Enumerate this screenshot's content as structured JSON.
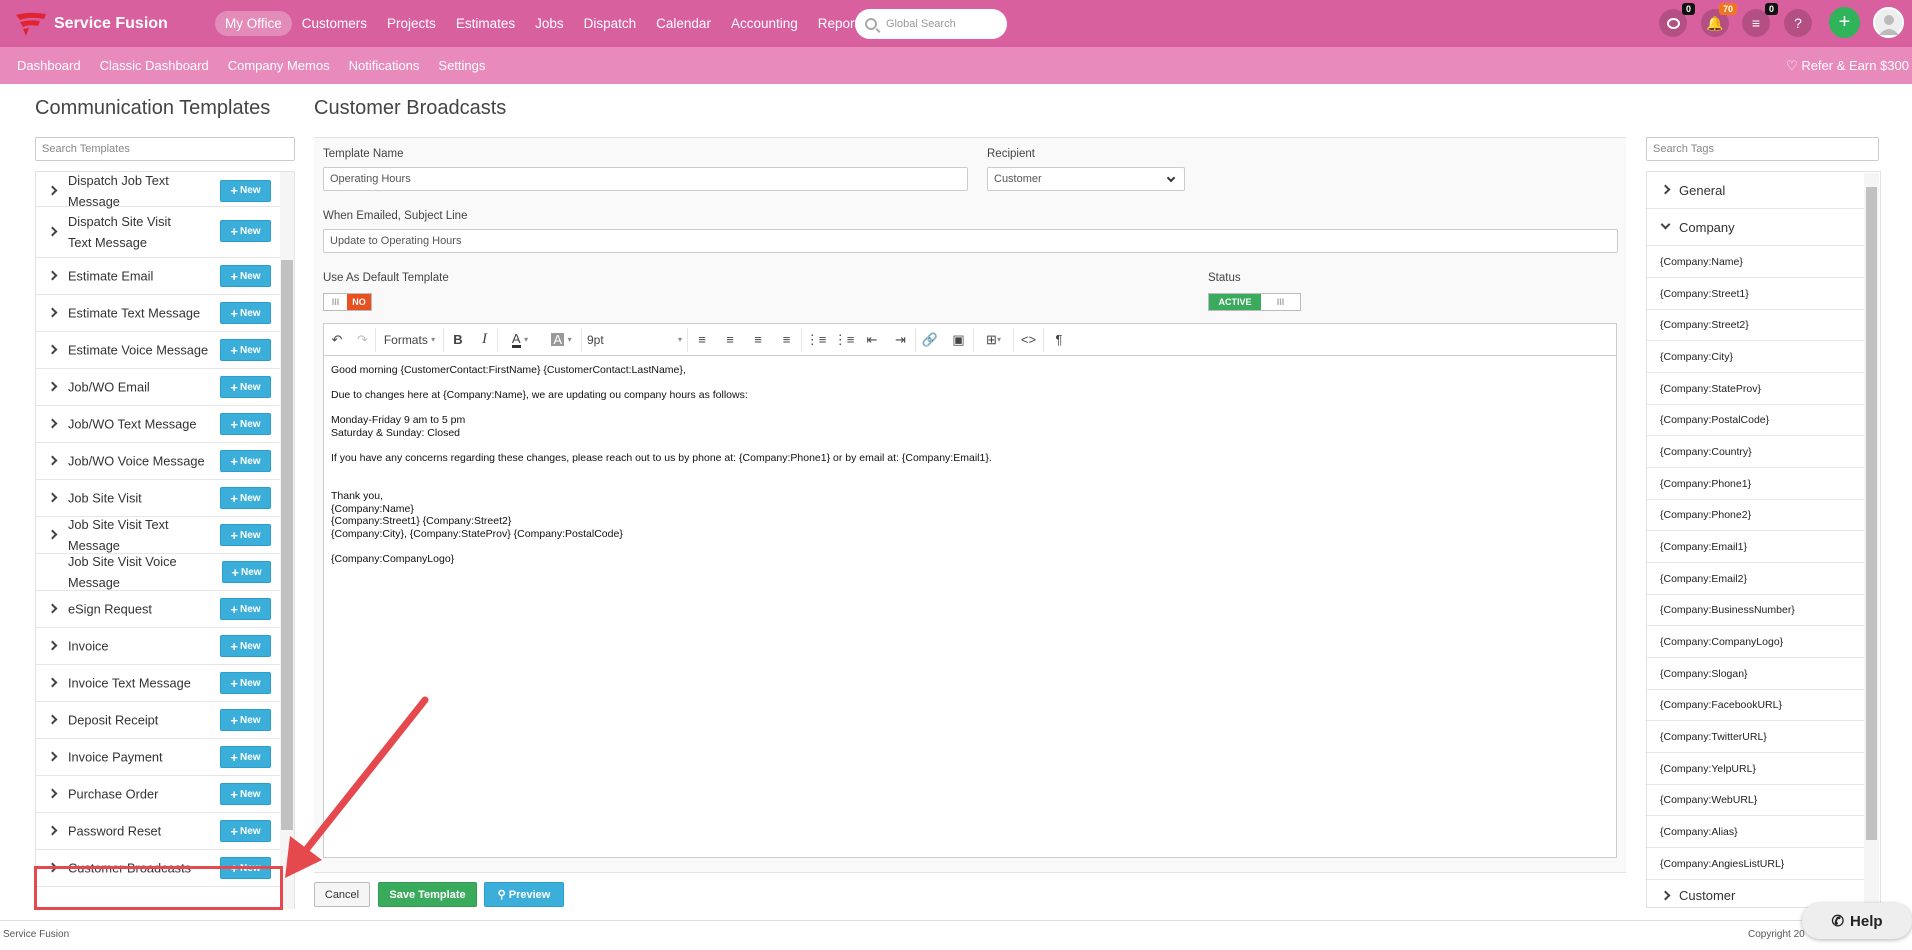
{
  "app": {
    "brand": "Service Fusion",
    "accent": "#d9609f",
    "subbar_color": "#e98abd"
  },
  "nav": {
    "items": [
      "My Office",
      "Customers",
      "Projects",
      "Estimates",
      "Jobs",
      "Dispatch",
      "Calendar",
      "Accounting",
      "Reports"
    ],
    "active": "My Office",
    "search_placeholder": "Global Search",
    "badges": {
      "chat": "0",
      "notifications": "70",
      "tasks": "0"
    },
    "help_label": "?"
  },
  "subnav": {
    "items": [
      "Dashboard",
      "Classic Dashboard",
      "Company Memos",
      "Notifications",
      "Settings"
    ],
    "refer": "♡  Refer & Earn $300"
  },
  "left": {
    "title": "Communication Templates",
    "search_placeholder": "Search Templates",
    "new_label": "New",
    "templates": [
      "Dispatch Job Text Message",
      "Dispatch Site Visit Text Message",
      "Estimate Email",
      "Estimate Text Message",
      "Estimate Voice Message",
      "Job/WO Email",
      "Job/WO Text Message",
      "Job/WO Voice Message",
      "Job Site Visit",
      "Job Site Visit Text Message",
      "Job Site Visit Voice Message",
      "eSign Request",
      "Invoice",
      "Invoice Text Message",
      "Deposit Receipt",
      "Invoice Payment",
      "Purchase Order",
      "Password Reset",
      "Customer Broadcasts"
    ],
    "highlighted": "Customer Broadcasts"
  },
  "form": {
    "title": "Customer Broadcasts",
    "template_name_label": "Template Name",
    "template_name_value": "Operating Hours",
    "recipient_label": "Recipient",
    "recipient_value": "Customer",
    "subject_label": "When Emailed, Subject Line",
    "subject_value": "Update to Operating Hours",
    "default_label": "Use As Default Template",
    "default_value": "NO",
    "status_label": "Status",
    "status_value": "ACTIVE",
    "toolbar": {
      "formats": "Formats",
      "font_size": "9pt"
    },
    "body": {
      "greeting": "Good morning {CustomerContact:FirstName} {CustomerContact:LastName},",
      "intro": "Due to changes here at {Company:Name}, we are updating ou company hours as follows:",
      "hours1": "Monday-Friday 9 am to 5 pm",
      "hours2": "Saturday & Sunday: Closed",
      "concerns": "If you have any concerns regarding these changes, please reach out to us by phone at: {Company:Phone1} or by email at: {Company:Email1}.",
      "thanks": "Thank you,",
      "sig1": "{Company:Name}",
      "sig2": "{Company:Street1} {Company:Street2}",
      "sig3": "{Company:City}, {Company:StateProv} {Company:PostalCode}",
      "logo": "{Company:CompanyLogo}"
    },
    "cancel": "Cancel",
    "save": "Save Template",
    "preview": "Preview"
  },
  "right": {
    "search_placeholder": "Search Tags",
    "groups": {
      "general": "General",
      "company": "Company",
      "customer": "Customer"
    },
    "company_tags": [
      "{Company:Name}",
      "{Company:Street1}",
      "{Company:Street2}",
      "{Company:City}",
      "{Company:StateProv}",
      "{Company:PostalCode}",
      "{Company:Country}",
      "{Company:Phone1}",
      "{Company:Phone2}",
      "{Company:Email1}",
      "{Company:Email2}",
      "{Company:BusinessNumber}",
      "{Company:CompanyLogo}",
      "{Company:Slogan}",
      "{Company:FacebookURL}",
      "{Company:TwitterURL}",
      "{Company:YelpURL}",
      "{Company:WebURL}",
      "{Company:Alias}",
      "{Company:AngiesListURL}"
    ]
  },
  "footer": {
    "left": "Service Fusion",
    "right": "Copyright 20"
  },
  "help": {
    "label": "Help"
  }
}
